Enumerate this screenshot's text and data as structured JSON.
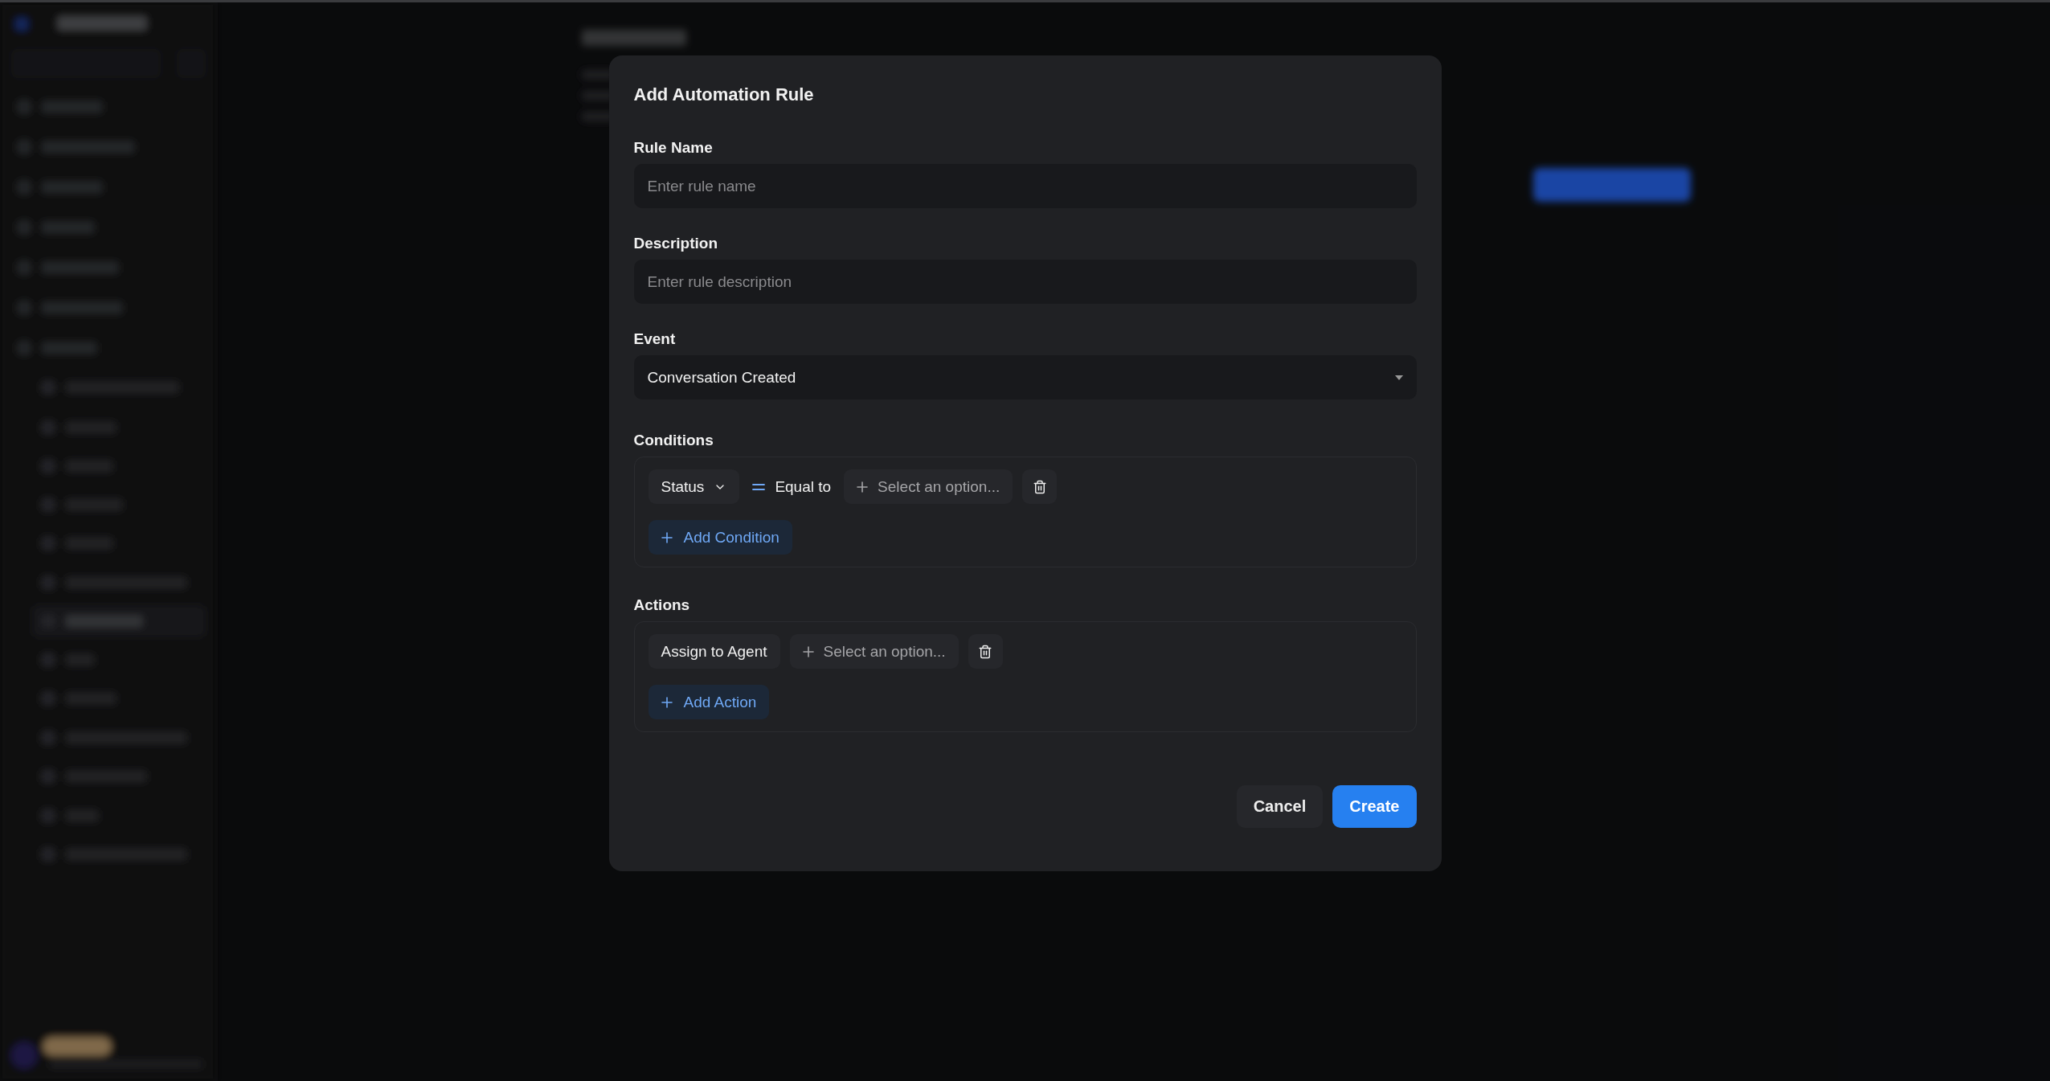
{
  "modal": {
    "title": "Add Automation Rule",
    "fields": [
      {
        "label": "Rule Name",
        "placeholder": "Enter rule name"
      },
      {
        "label": "Description",
        "placeholder": "Enter rule description"
      }
    ],
    "event": {
      "label": "Event",
      "value": "Conversation Created"
    },
    "conditions": {
      "label": "Conditions",
      "rows": [
        {
          "attribute": "Status",
          "operator": "Equal to",
          "value_placeholder": "Select an option..."
        }
      ],
      "add_button": "Add Condition"
    },
    "actions": {
      "label": "Actions",
      "rows": [
        {
          "action": "Assign to Agent",
          "value_placeholder": "Select an option..."
        }
      ],
      "add_button": "Add Action"
    },
    "buttons": {
      "cancel": "Cancel",
      "create": "Create"
    }
  }
}
